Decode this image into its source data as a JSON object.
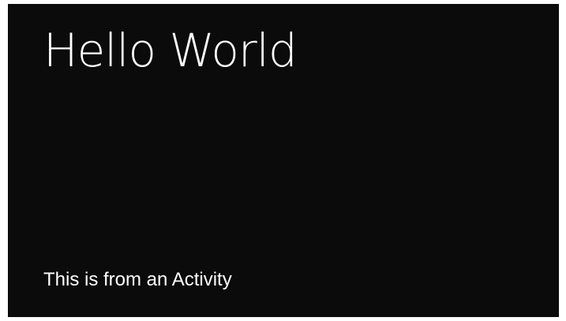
{
  "card": {
    "headline": "Hello World",
    "footnote": "This is from an Activity"
  },
  "colors": {
    "background": "#0b0b0b",
    "text": "#ffffff",
    "frame": "#ffffff"
  }
}
